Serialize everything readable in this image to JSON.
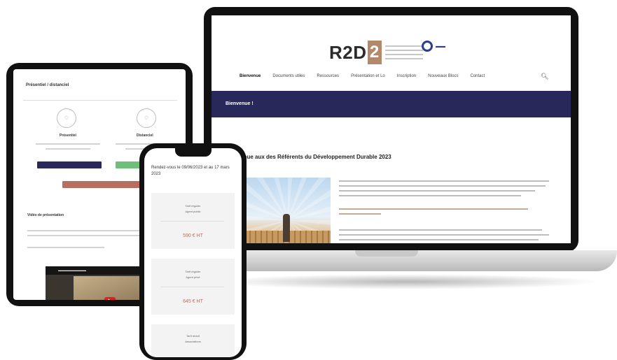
{
  "laptop": {
    "brand": {
      "name": "R2D",
      "mark": "2"
    },
    "nav": {
      "items": [
        "Bienvenue",
        "Documents utiles",
        "Ressources",
        "Présentation et Lo",
        "Inscription",
        "Nouveaux Blocs",
        "Contact"
      ]
    },
    "banner_title": "Bienvenue !",
    "post_heading": "...venue aux des Référents du Développement Durable 2023"
  },
  "tablet": {
    "title": "Présentiel / distanciel",
    "options": [
      "Présentiel",
      "Distanciel"
    ],
    "subheading": "Vidéo de présentation"
  },
  "phone": {
    "heading": "Rendez-vous le 09/06/2023 et au 17 mars 2023",
    "cards": [
      {
        "line1": "Tarif régulier",
        "line2": "Agent public",
        "price": "590 € HT"
      },
      {
        "line1": "Tarif régulier",
        "line2": "Agent privé",
        "price": "645 € HT"
      },
      {
        "line1": "Tarif réduit",
        "line2": "Associations"
      }
    ]
  },
  "colors": {
    "navy": "#28285a",
    "rust": "#b86e5f",
    "green": "#6fbf7a",
    "brand_mark": "#b4886a"
  }
}
